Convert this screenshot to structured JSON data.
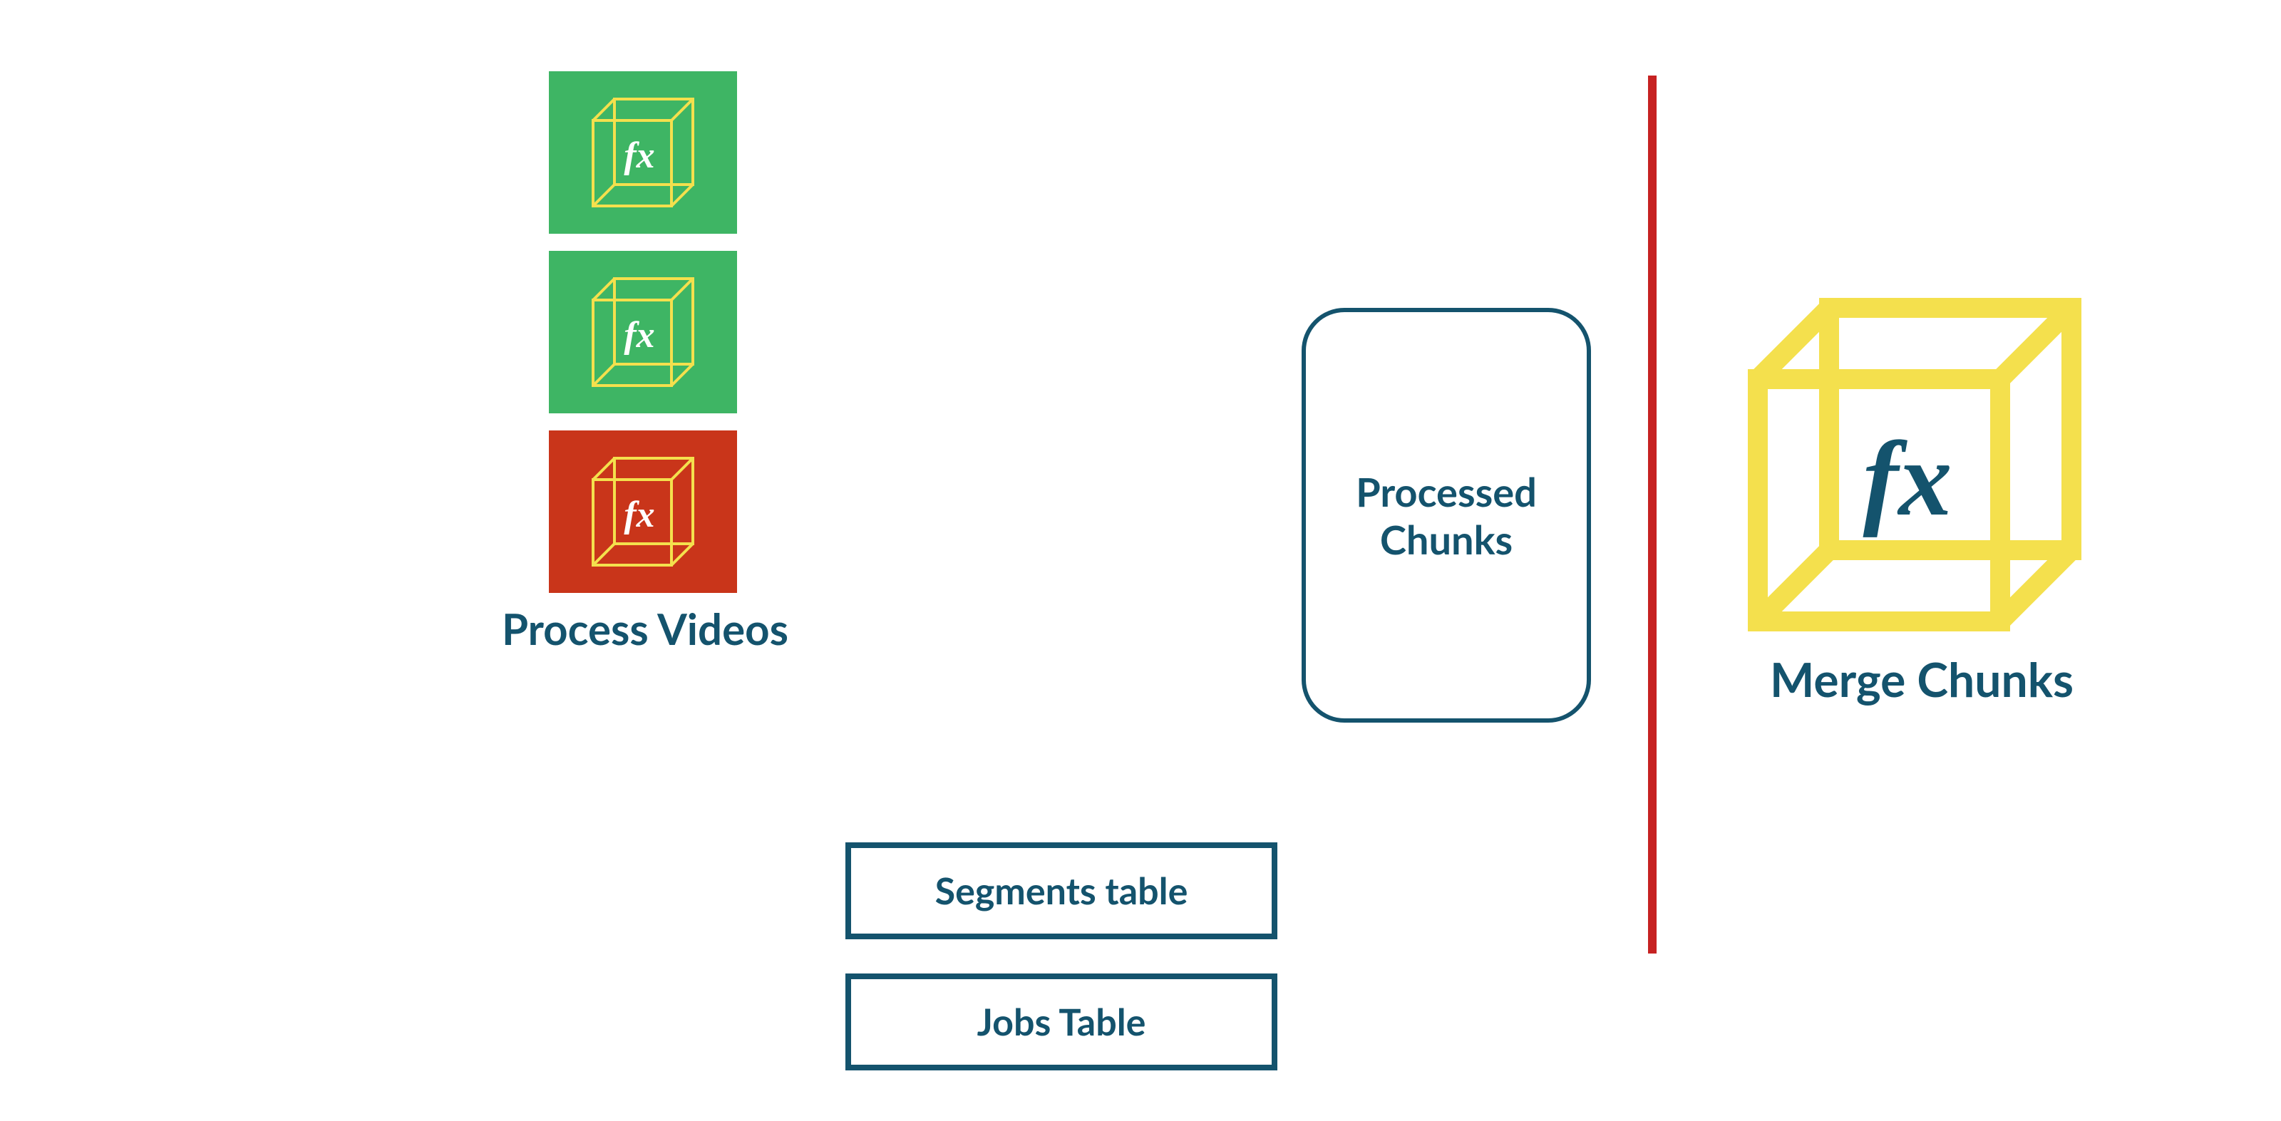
{
  "colors": {
    "green": "#3eb564",
    "red": "#c9351a",
    "navy": "#14536d",
    "yellow": "#f4e04d",
    "redline": "#c62222"
  },
  "left": {
    "tiles": [
      {
        "bg": "green",
        "icon": "fx-cube"
      },
      {
        "bg": "green",
        "icon": "fx-cube"
      },
      {
        "bg": "red",
        "icon": "fx-cube"
      }
    ],
    "caption": "Process Videos"
  },
  "center": {
    "box_label_line1": "Processed",
    "box_label_line2": "Chunks",
    "tables": [
      {
        "label": "Segments table"
      },
      {
        "label": "Jobs Table"
      }
    ]
  },
  "right": {
    "big_icon": "fx-cube-big",
    "caption": "Merge Chunks"
  }
}
